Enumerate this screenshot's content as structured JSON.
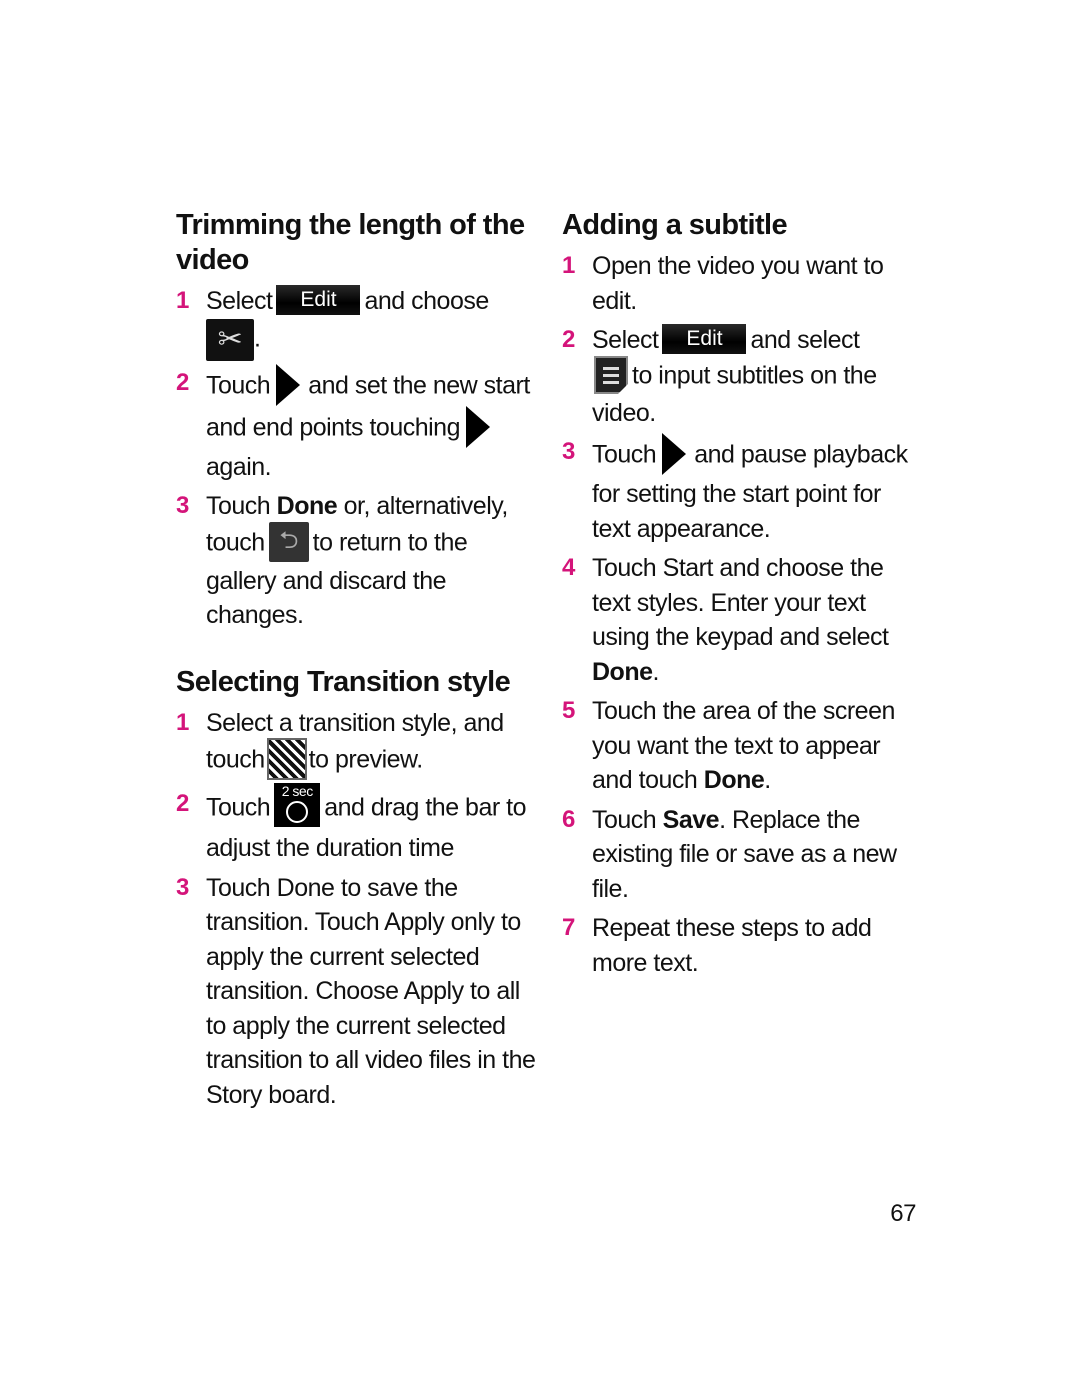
{
  "page_number": "67",
  "accent_color": "#d4147a",
  "left_column": {
    "trimming": {
      "title": "Trimming the length of the video",
      "steps": [
        {
          "num": "1",
          "t1": "Select",
          "button": "Edit",
          "t2": "and choose",
          "icon": "scissors-trim-icon",
          "t3": "."
        },
        {
          "num": "2",
          "t1": "Touch",
          "icon": "play-icon",
          "t2": "and set the new start and end points touching",
          "icon2": "play-icon",
          "t3": "again."
        },
        {
          "num": "3",
          "t1": "Touch",
          "bold": "Done",
          "t2": "or, alternatively, touch",
          "icon": "back-icon",
          "t3": "to return to the gallery and discard the changes."
        }
      ]
    },
    "transition": {
      "title": "Selecting Transition style",
      "steps": [
        {
          "num": "1",
          "t1": "Select a transition style, and touch",
          "icon": "transition-preview-icon",
          "t2": "to preview."
        },
        {
          "num": "2",
          "t1": "Touch",
          "icon": "duration-2sec-icon",
          "icon_label": "2 sec",
          "t2": "and drag the bar to adjust the duration time"
        },
        {
          "num": "3",
          "t1": "Touch Done to save the transition. Touch Apply only to apply the current selected transition. Choose Apply to all to apply the current selected transition to all video files in the Story board."
        }
      ]
    }
  },
  "right_column": {
    "subtitle": {
      "title": "Adding a subtitle",
      "steps": [
        {
          "num": "1",
          "t1": "Open the video you want to edit."
        },
        {
          "num": "2",
          "t1": "Select",
          "button": "Edit",
          "t2": "and select",
          "icon": "subtitle-icon",
          "t3": "to input subtitles on the video."
        },
        {
          "num": "3",
          "t1": "Touch",
          "icon": "play-icon",
          "t2": "and pause playback for setting the start point for text appearance."
        },
        {
          "num": "4",
          "t1": "Touch Start and choose the text styles. Enter your text using the keypad and select",
          "bold": "Done",
          "t2": "."
        },
        {
          "num": "5",
          "t1": "Touch the area of the screen you want the text to appear and touch",
          "bold": "Done",
          "t2": "."
        },
        {
          "num": "6",
          "t1": "Touch",
          "bold": "Save",
          "t2": ". Replace the existing file or save as a new file."
        },
        {
          "num": "7",
          "t1": "Repeat these steps to add more text."
        }
      ]
    }
  }
}
